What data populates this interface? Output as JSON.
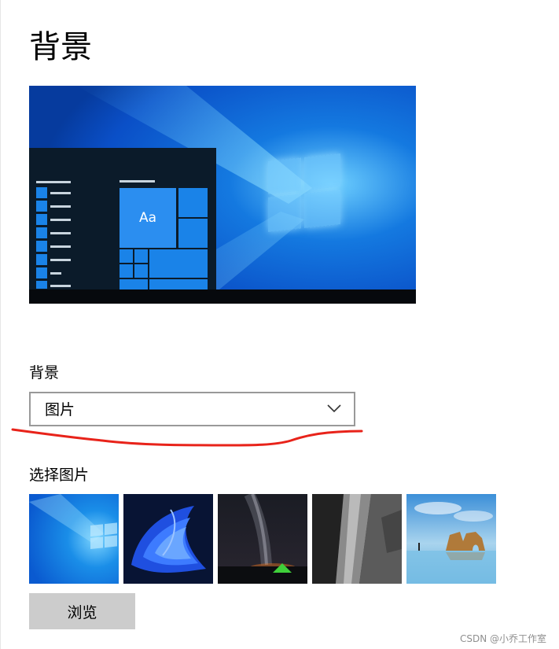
{
  "page": {
    "title": "背景"
  },
  "preview": {
    "sample_text": "Aa"
  },
  "background": {
    "label": "背景",
    "dropdown_value": "图片"
  },
  "choose_picture": {
    "label": "选择图片",
    "thumbnails": [
      {
        "name": "windows-blue-light"
      },
      {
        "name": "blue-bloom"
      },
      {
        "name": "milky-way-tent"
      },
      {
        "name": "rock-waterfall"
      },
      {
        "name": "beach-rock-arch"
      }
    ],
    "browse_label": "浏览"
  },
  "watermark": "CSDN @小乔工作室",
  "colors": {
    "accent": "#1a83e8",
    "annotation_red": "#e8231a",
    "dropdown_border": "#999999",
    "browse_bg": "#cccccc"
  }
}
